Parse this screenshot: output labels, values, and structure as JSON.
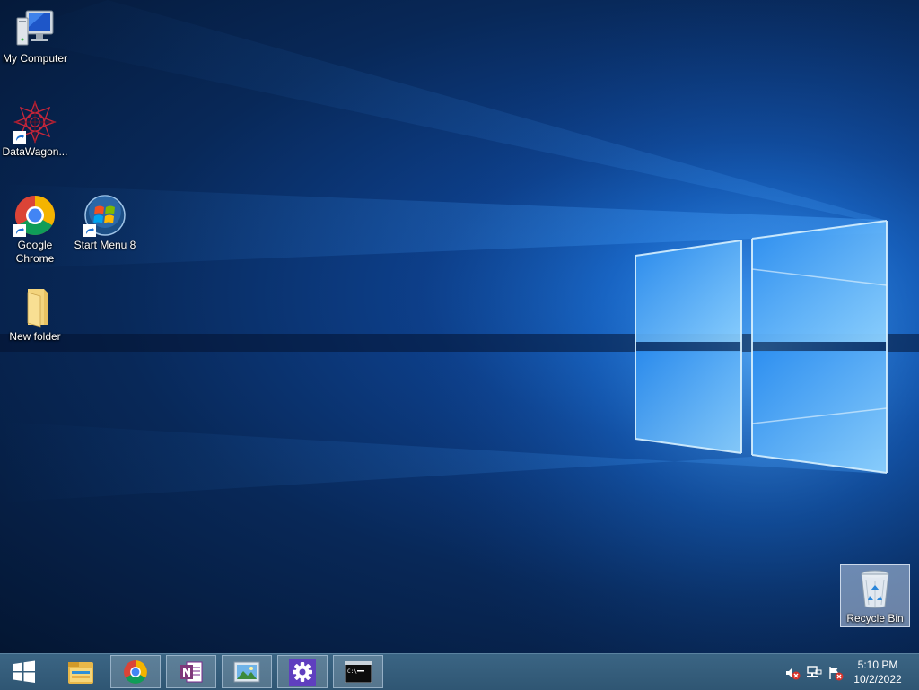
{
  "desktop": {
    "icons": [
      {
        "label": "My Computer",
        "icon": "computer-icon"
      },
      {
        "label": "DataWagon...",
        "icon": "datawagon-icon",
        "shortcut": true
      },
      {
        "label": "Google Chrome",
        "icon": "chrome-icon",
        "shortcut": true
      },
      {
        "label": "Start Menu 8",
        "icon": "start-menu-8-icon",
        "shortcut": true
      },
      {
        "label": "New folder",
        "icon": "folder-icon"
      },
      {
        "label": "Recycle Bin",
        "icon": "recycle-bin-icon",
        "selected": true
      }
    ]
  },
  "taskbar": {
    "buttons": [
      {
        "icon": "windows-start-icon"
      },
      {
        "icon": "file-explorer-icon"
      },
      {
        "icon": "chrome-icon",
        "active": true
      },
      {
        "icon": "onenote-icon"
      },
      {
        "icon": "photos-icon"
      },
      {
        "icon": "settings-gear-icon"
      },
      {
        "icon": "command-prompt-icon"
      }
    ],
    "tray": [
      {
        "icon": "volume-muted-icon"
      },
      {
        "icon": "network-icon"
      },
      {
        "icon": "action-center-flag-icon"
      }
    ],
    "clock": {
      "time": "5:10 PM",
      "date": "10/2/2022"
    }
  },
  "colors": {
    "wallpaper_dark": "#041632",
    "wallpaper_light": "#1b6fd6",
    "taskbar": "#345c7a"
  }
}
